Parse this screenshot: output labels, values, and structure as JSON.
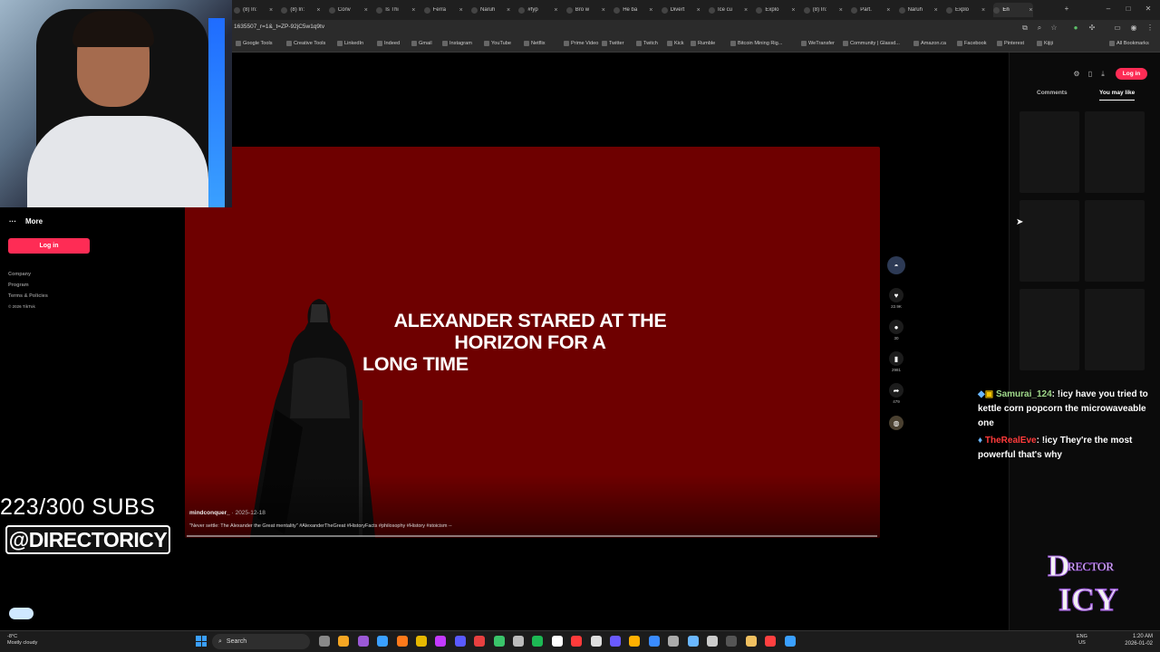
{
  "browser": {
    "tabs": [
      "(8) In:",
      "(8) In:",
      "Conv",
      "Is Thi",
      "Ferra",
      "Naruh",
      "#fyp",
      "Bro w",
      "He ba",
      "Divert",
      "Ice cu",
      "Explo",
      "(8) In:",
      "Part.",
      "Naruh",
      "Explo",
      "En"
    ],
    "url": "1635507_r=1&_t=ZP-92jC5w1q9tv",
    "bookmarks": [
      "Google Tools",
      "Creative Tools",
      "LinkedIn",
      "Indeed",
      "Gmail",
      "Instagram",
      "YouTube",
      "Netflix",
      "Prime Video",
      "Twitter",
      "Twitch",
      "Kick",
      "Rumble",
      "Bitcoin Mining Rig...",
      "WeTransfer",
      "Community | Glassd...",
      "Amazon.ca",
      "Facebook",
      "Pinterest",
      "Kijiji"
    ],
    "all_bookmarks": "All Bookmarks"
  },
  "sidebar": {
    "more": "More",
    "login": "Log in",
    "footer": [
      "Company",
      "Program",
      "Terms & Policies",
      "© 2026 TikTok"
    ]
  },
  "video": {
    "caption_line1": "ALEXANDER STARED AT THE",
    "caption_line2": "HORIZON FOR A",
    "caption_line3": "LONG TIME",
    "author": "mindconquer_",
    "date": " · 2025-12-18",
    "description": "\"Never settle: The Alexander the Great mentality\" #AlexanderTheGreat #HistoryFacts #philosophy #History #stoicism --"
  },
  "actions": {
    "likes": "22.9K",
    "comments": "30",
    "saves": "2981",
    "shares": "479"
  },
  "right_panel": {
    "login": "Log in",
    "tab_comments": "Comments",
    "tab_you_may_like": "You may like"
  },
  "overlay": {
    "subs": "223/300 SUBS",
    "handle": "@DIRECTORICY",
    "logo_line1": "DIRECTOR",
    "logo_line2": "ICY"
  },
  "chat": [
    {
      "user": "Samurai_124",
      "message": ": !icy have you tried to kettle corn popcorn the microwaveable one"
    },
    {
      "user": "TheRealEve",
      "message": ": !icy They're the most powerful that's why"
    }
  ],
  "taskbar": {
    "weather_temp": "-8°C",
    "weather_desc": "Mostly cloudy",
    "search": "Search",
    "lang1": "ENG",
    "lang2": "US",
    "time": "1:20 AM",
    "date": "2026-01-02"
  },
  "colors": {
    "tiktok_red": "#fe2c55",
    "video_bg": "#6e0000",
    "chat_user1": "#9fd88a",
    "chat_user2": "#ff3b3b"
  }
}
